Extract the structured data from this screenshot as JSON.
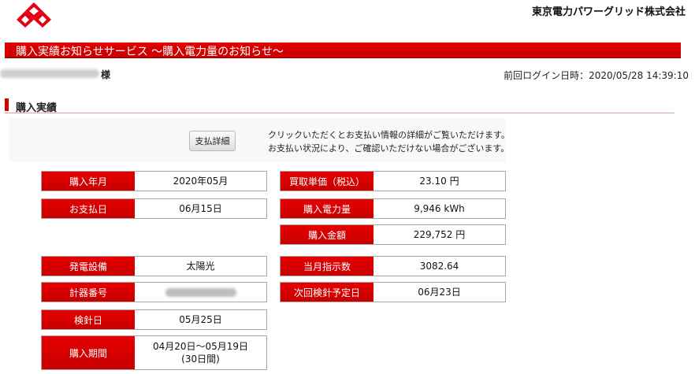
{
  "header": {
    "company": "東京電力パワーグリッド株式会社",
    "service_title": "購入実績お知らせサービス ～購入電力量のお知らせ～",
    "brand_color": "#e60012"
  },
  "user": {
    "honorific": "様",
    "last_login": "前回ログイン日時：2020/05/28 14:39:10"
  },
  "section": {
    "title": "購入実績",
    "detail_button": "支払詳細",
    "notice": [
      "クリックいただくとお支払い情報の詳細がご覧いただけます。",
      "お支払い状況により、ご確認いただけない場合がございます。"
    ]
  },
  "left": {
    "purchase_month": {
      "label": "購入年月",
      "value": "2020年05月"
    },
    "payment_date": {
      "label": "お支払日",
      "value": "06月15日"
    },
    "facility": {
      "label": "発電設備",
      "value": "太陽光"
    },
    "meter_no": {
      "label": "計器番号",
      "value": ""
    },
    "reading_date": {
      "label": "検針日",
      "value": "05月25日"
    },
    "period": {
      "label": "購入期間",
      "value": "04月20日～05月19日",
      "days": "(30日間)"
    }
  },
  "right": {
    "unit_price": {
      "label": "買取単価（税込）",
      "value": "23.10 円"
    },
    "energy": {
      "label": "購入電力量",
      "value": "9,946 kWh"
    },
    "amount": {
      "label": "購入金額",
      "value": "229,752 円"
    },
    "meter_reading": {
      "label": "当月指示数",
      "value": "3082.64"
    },
    "next_reading": {
      "label": "次回検針予定日",
      "value": "06月23日"
    }
  }
}
